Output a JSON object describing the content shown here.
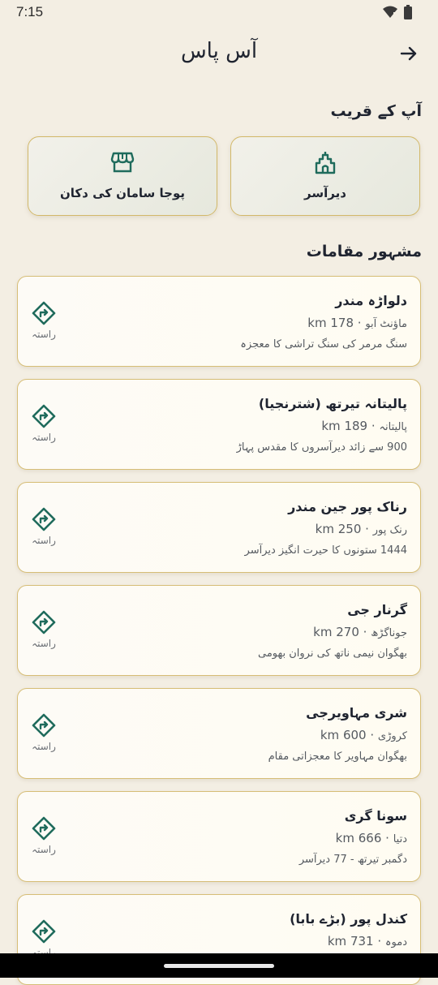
{
  "status_bar": {
    "time": "7:15"
  },
  "header": {
    "title": "آس پاس"
  },
  "nearby": {
    "title": "آپ کے قریب",
    "categories": [
      {
        "label": "دیرآسر",
        "icon": "temple-icon"
      },
      {
        "label": "پوجا سامان کی دکان",
        "icon": "store-icon"
      }
    ]
  },
  "famous": {
    "title": "مشہور مقامات",
    "directions_label": "راستہ",
    "places": [
      {
        "name": "دلواڑہ مندر",
        "city": "ماؤنٹ آبو",
        "distance": "178 km",
        "desc": "سنگ مرمر کی سنگ تراشی کا معجزہ"
      },
      {
        "name": "پالیتانہ تیرتھ (شترنجیا)",
        "city": "پالیتانہ",
        "distance": "189 km",
        "desc": "900 سے زائد دیرآسروں کا مقدس پہاڑ"
      },
      {
        "name": "رناک پور جین مندر",
        "city": "رنک پور",
        "distance": "250 km",
        "desc": "1444 ستونوں کا حیرت انگیز دیرآسر"
      },
      {
        "name": "گرنار جی",
        "city": "جوناگڑھ",
        "distance": "270 km",
        "desc": "بھگوان نیمی ناتھ کی نروان بھومی"
      },
      {
        "name": "شری مہاویرجی",
        "city": "کروڑی",
        "distance": "600 km",
        "desc": "بھگوان مہاویر کا معجزاتی مقام"
      },
      {
        "name": "سونا گری",
        "city": "دتیا",
        "distance": "666 km",
        "desc": "دگمبر تیرتھ - 77 دیرآسر"
      },
      {
        "name": "کندل پور (بڑے بابا)",
        "city": "دموہ",
        "distance": "731 km",
        "desc": ""
      }
    ]
  },
  "colors": {
    "accent": "#1f6b5c",
    "gold_border": "#d2b869",
    "background": "#f3eee3"
  }
}
